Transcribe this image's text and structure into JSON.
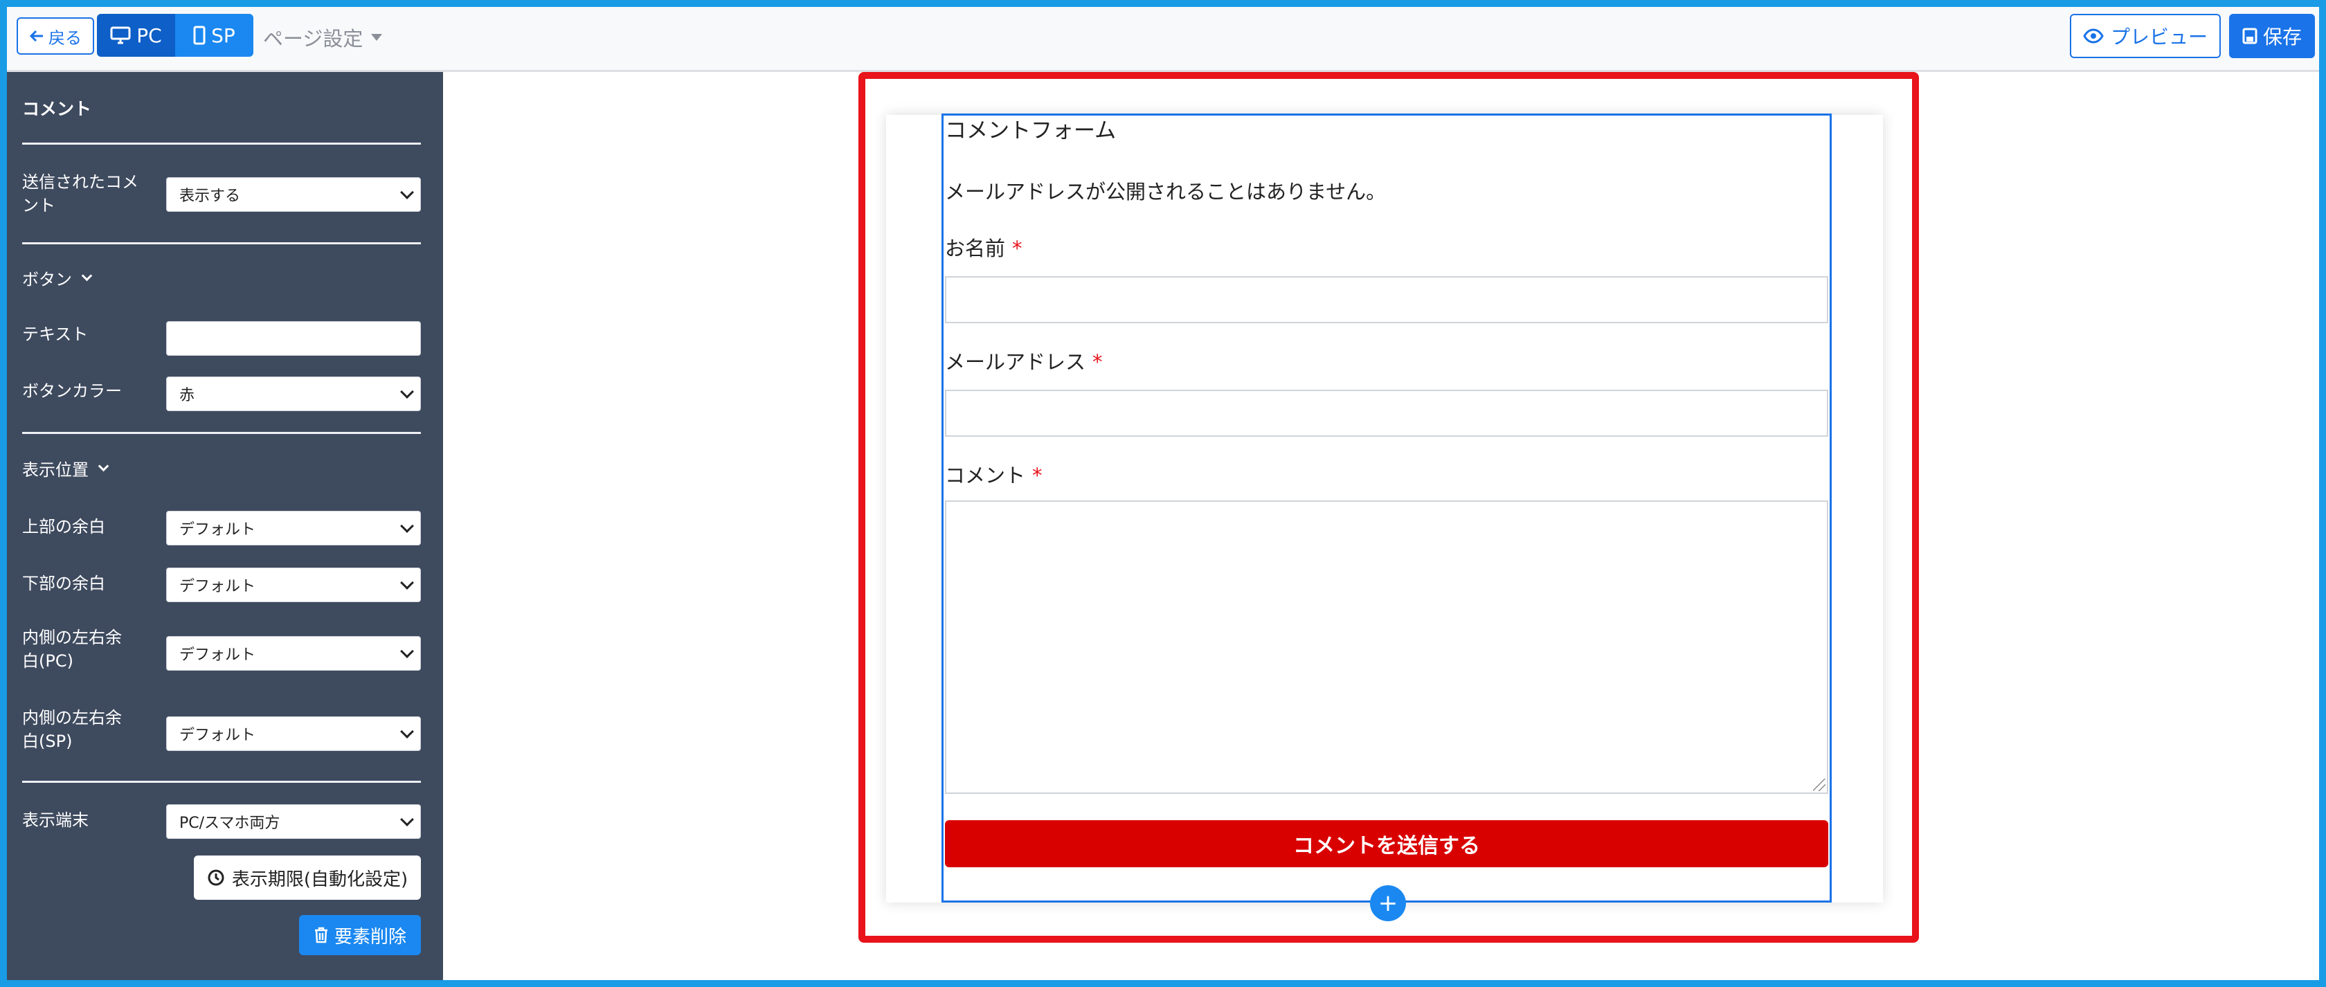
{
  "header": {
    "back_label": "戻る",
    "pc_label": "PC",
    "sp_label": "SP",
    "page_settings_label": "ページ設定",
    "preview_label": "プレビュー",
    "save_label": "保存"
  },
  "sidebar": {
    "title": "コメント",
    "submitted_comments_label": "送信されたコメント",
    "submitted_comments_value": "表示する",
    "button_section": "ボタン",
    "text_label": "テキスト",
    "text_value": "",
    "button_color_label": "ボタンカラー",
    "button_color_value": "赤",
    "position_section": "表示位置",
    "top_margin_label": "上部の余白",
    "top_margin_value": "デフォルト",
    "bottom_margin_label": "下部の余白",
    "bottom_margin_value": "デフォルト",
    "inner_pc_label": "内側の左右余白(PC)",
    "inner_pc_value": "デフォルト",
    "inner_sp_label": "内側の左右余白(SP)",
    "inner_sp_value": "デフォルト",
    "device_label": "表示端末",
    "device_value": "PC/スマホ両方",
    "schedule_button": "表示期限(自動化設定)",
    "delete_button": "要素削除"
  },
  "form": {
    "title": "コメントフォーム",
    "note": "メールアドレスが公開されることはありません。",
    "name_label": "お名前",
    "email_label": "メールアドレス",
    "comment_label": "コメント",
    "required_mark": "*",
    "submit_label": "コメントを送信する",
    "add_label": "+"
  },
  "colors": {
    "accent": "#1a73e8",
    "sidebar_bg": "#3e4a5e",
    "highlight_frame": "#e8131b",
    "submit_bg": "#d90000"
  }
}
